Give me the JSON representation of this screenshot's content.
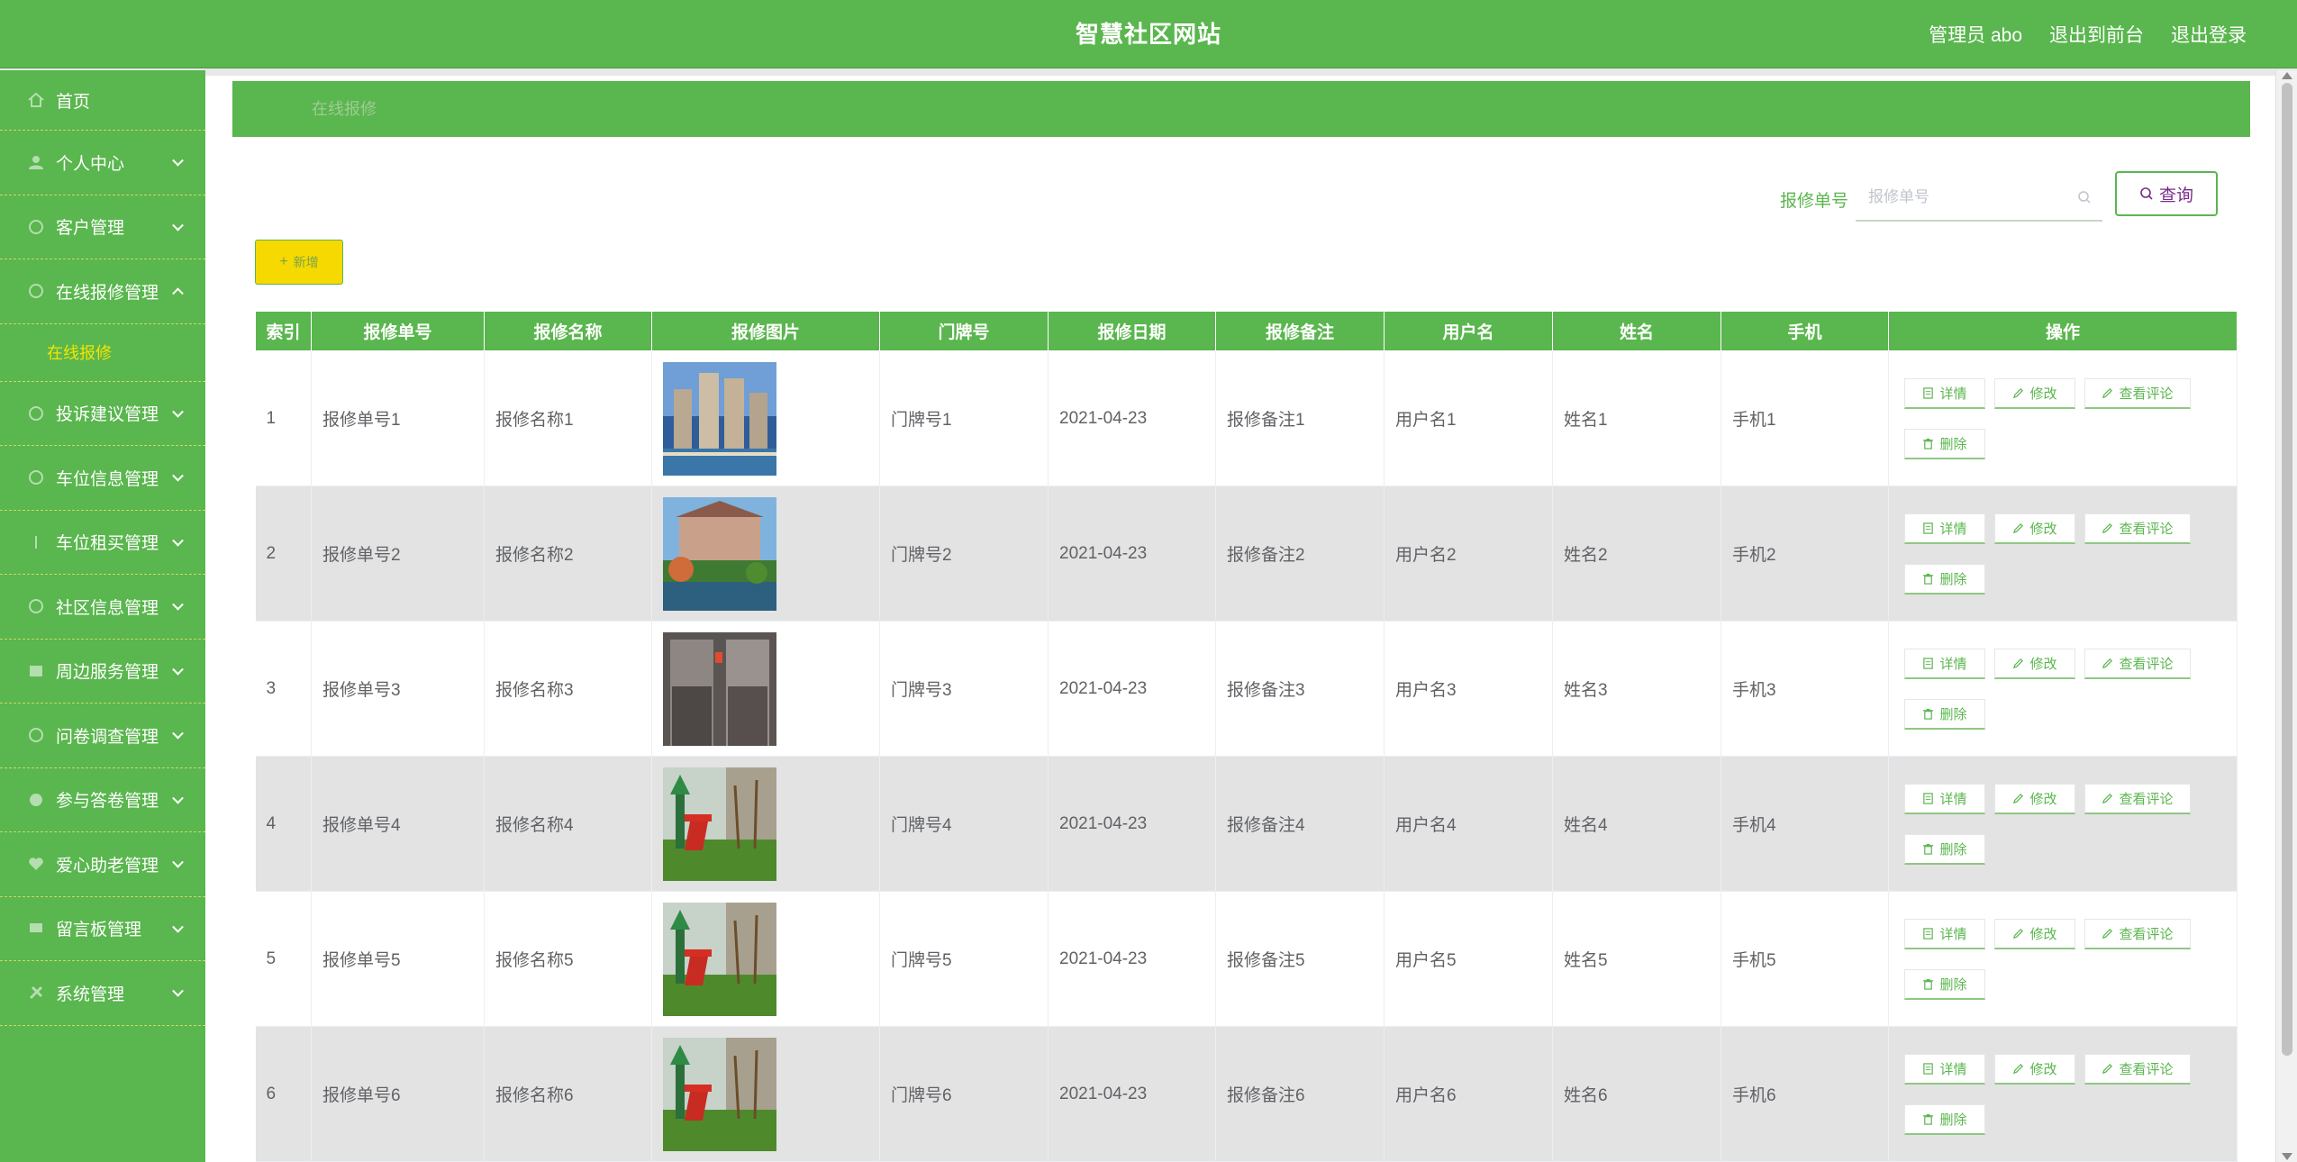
{
  "header": {
    "title": "智慧社区网站",
    "admin": "管理员 abo",
    "to_front": "退出到前台",
    "logout": "退出登录"
  },
  "sidebar": {
    "items": [
      {
        "label": "首页",
        "icon": "home-icon",
        "expandable": false
      },
      {
        "label": "个人中心",
        "icon": "user-icon",
        "expandable": true
      },
      {
        "label": "客户管理",
        "icon": "customers-icon",
        "expandable": true
      },
      {
        "label": "在线报修管理",
        "icon": "repair-icon",
        "expandable": true,
        "expanded": true
      },
      {
        "label": "投诉建议管理",
        "icon": "complaint-icon",
        "expandable": true
      },
      {
        "label": "车位信息管理",
        "icon": "parking-icon",
        "expandable": true
      },
      {
        "label": "车位租买管理",
        "icon": "car-icon",
        "expandable": true
      },
      {
        "label": "社区信息管理",
        "icon": "community-icon",
        "expandable": true
      },
      {
        "label": "周边服务管理",
        "icon": "service-icon",
        "expandable": true
      },
      {
        "label": "问卷调查管理",
        "icon": "survey-icon",
        "expandable": true
      },
      {
        "label": "参与答卷管理",
        "icon": "answer-icon",
        "expandable": true
      },
      {
        "label": "爱心助老管理",
        "icon": "heart-icon",
        "expandable": true
      },
      {
        "label": "留言板管理",
        "icon": "message-icon",
        "expandable": true
      },
      {
        "label": "系统管理",
        "icon": "settings-icon",
        "expandable": true
      }
    ],
    "submenu": {
      "label": "在线报修",
      "active_color": "#f5e400"
    }
  },
  "breadcrumb": "在线报修",
  "search": {
    "label": "报修单号",
    "placeholder": "报修单号",
    "button": "查询"
  },
  "add_button": "新增",
  "table": {
    "headers": [
      "索引",
      "报修单号",
      "报修名称",
      "报修图片",
      "门牌号",
      "报修日期",
      "报修备注",
      "用户名",
      "姓名",
      "手机",
      "操作"
    ],
    "rows": [
      {
        "index": "1",
        "order_no": "报修单号1",
        "name": "报修名称1",
        "image": "building",
        "door": "门牌号1",
        "date": "2021-04-23",
        "note": "报修备注1",
        "username": "用户名1",
        "realname": "姓名1",
        "phone": "手机1"
      },
      {
        "index": "2",
        "order_no": "报修单号2",
        "name": "报修名称2",
        "image": "villa",
        "door": "门牌号2",
        "date": "2021-04-23",
        "note": "报修备注2",
        "username": "用户名2",
        "realname": "姓名2",
        "phone": "手机2"
      },
      {
        "index": "3",
        "order_no": "报修单号3",
        "name": "报修名称3",
        "image": "elevator",
        "door": "门牌号3",
        "date": "2021-04-23",
        "note": "报修备注3",
        "username": "用户名3",
        "realname": "姓名3",
        "phone": "手机3"
      },
      {
        "index": "4",
        "order_no": "报修单号4",
        "name": "报修名称4",
        "image": "playground",
        "door": "门牌号4",
        "date": "2021-04-23",
        "note": "报修备注4",
        "username": "用户名4",
        "realname": "姓名4",
        "phone": "手机4"
      },
      {
        "index": "5",
        "order_no": "报修单号5",
        "name": "报修名称5",
        "image": "playground",
        "door": "门牌号5",
        "date": "2021-04-23",
        "note": "报修备注5",
        "username": "用户名5",
        "realname": "姓名5",
        "phone": "手机5"
      },
      {
        "index": "6",
        "order_no": "报修单号6",
        "name": "报修名称6",
        "image": "playground",
        "door": "门牌号6",
        "date": "2021-04-23",
        "note": "报修备注6",
        "username": "用户名6",
        "realname": "姓名6",
        "phone": "手机6"
      }
    ],
    "actions": {
      "detail": "详情",
      "edit": "修改",
      "comments": "查看评论",
      "delete": "删除"
    }
  },
  "colors": {
    "primary": "#5ab64e",
    "accent_yellow": "#f5d900",
    "submenu_active": "#f5e400",
    "row_alt": "#e3e3e3"
  }
}
